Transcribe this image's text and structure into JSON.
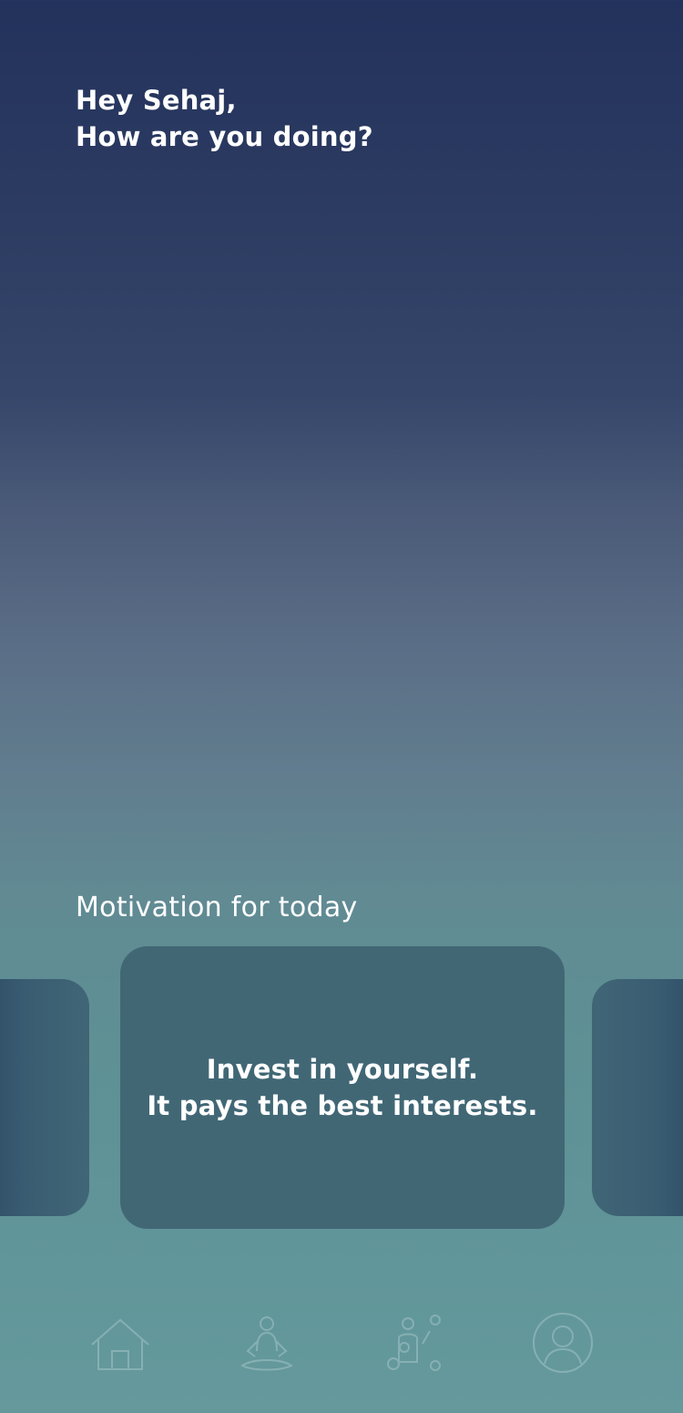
{
  "greeting": {
    "line1": "Hey Sehaj,",
    "line2": "How are you doing?"
  },
  "motivation": {
    "section_title": "Motivation for today",
    "quote_line1": "Invest in yourself.",
    "quote_line2": "It pays the best interests."
  },
  "bottom_nav": {
    "items": [
      {
        "icon": "home-icon"
      },
      {
        "icon": "meditation-icon"
      },
      {
        "icon": "activities-icon"
      },
      {
        "icon": "profile-icon"
      }
    ]
  },
  "colors": {
    "background_top": "#23325c",
    "background_bottom": "#65999c",
    "card": "#416775",
    "text": "#ffffff"
  }
}
